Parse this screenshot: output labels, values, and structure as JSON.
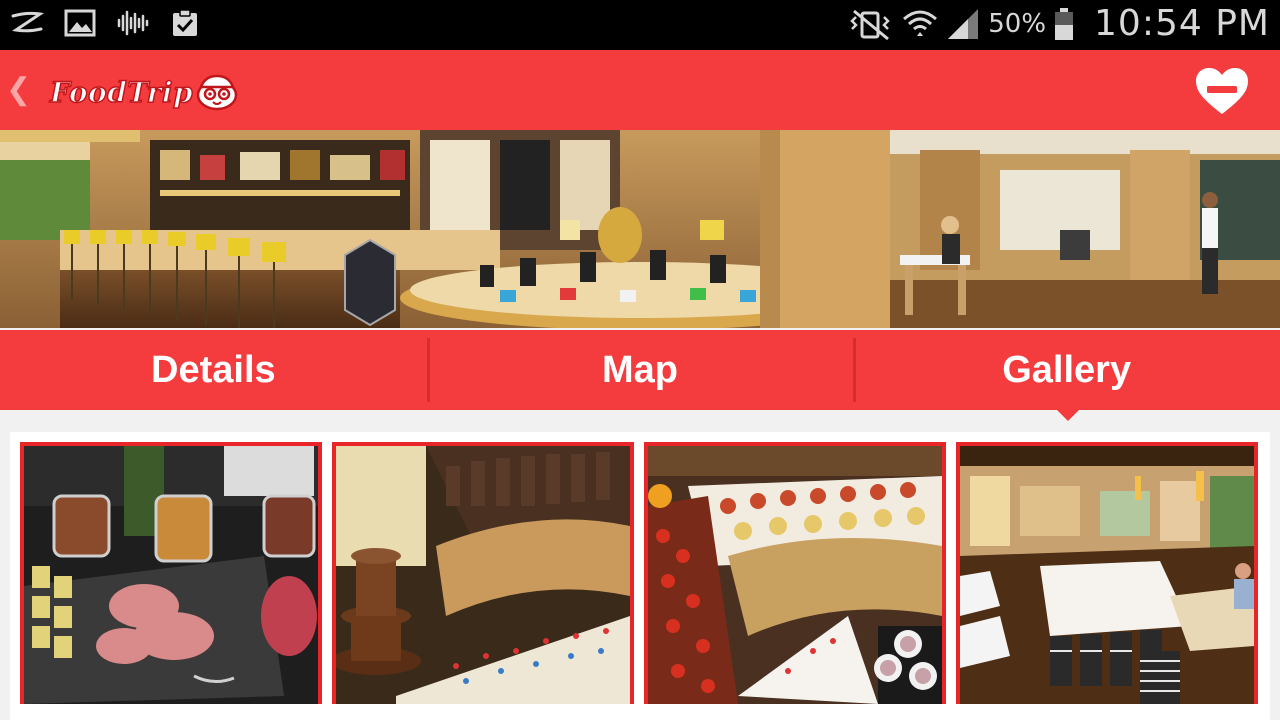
{
  "status_bar": {
    "battery": "50%",
    "time": "10:54 PM",
    "icons": [
      "notification-z-icon",
      "image-icon",
      "voicemail-icon",
      "task-check-icon",
      "mute-vibrate-icon",
      "wifi-icon",
      "signal-icon",
      "battery-icon"
    ]
  },
  "app_bar": {
    "logo": "FoodTrip",
    "icons": [
      "back-chevron-icon",
      "remove-favorite-heart-icon"
    ],
    "color": "#f43b3d"
  },
  "tabs": {
    "items": [
      "Details",
      "Map",
      "Gallery"
    ],
    "selected": "Gallery"
  },
  "gallery": {
    "images": [
      "buffet-jars-cold-cuts",
      "chocolate-fountain-desserts",
      "canape-display",
      "dining-room-interior"
    ]
  }
}
